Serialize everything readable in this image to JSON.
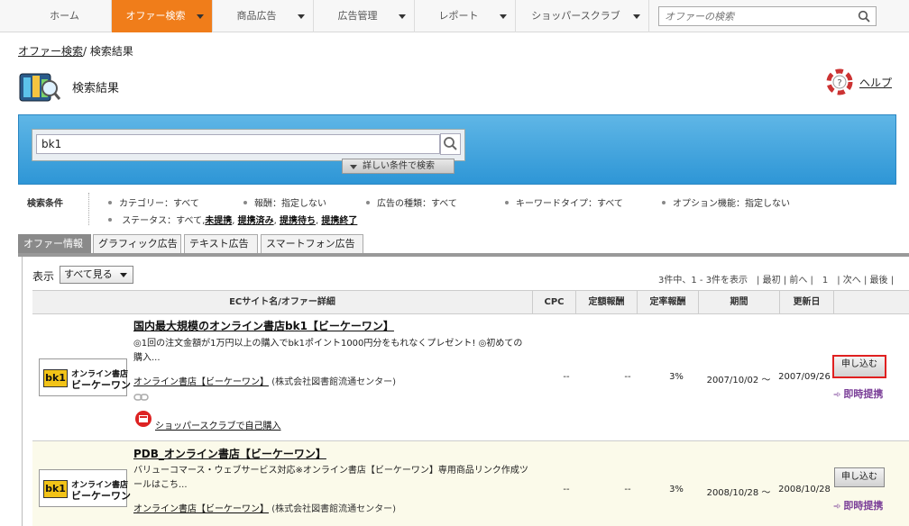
{
  "nav": {
    "items": [
      {
        "label": "ホーム",
        "active": false,
        "dropdown": false
      },
      {
        "label": "オファー検索",
        "active": true,
        "dropdown": true
      },
      {
        "label": "商品広告",
        "active": false,
        "dropdown": true
      },
      {
        "label": "広告管理",
        "active": false,
        "dropdown": true
      },
      {
        "label": "レポート",
        "active": false,
        "dropdown": true
      },
      {
        "label": "ショッパースクラブ",
        "active": false,
        "dropdown": true
      }
    ],
    "search_placeholder": "オファーの検索"
  },
  "breadcrumb": {
    "link": "オファー検索",
    "current": "/ 検索結果"
  },
  "page": {
    "title": "検索結果",
    "help": "ヘルプ"
  },
  "search": {
    "value": "bk1",
    "advanced_label": "詳しい条件で検索"
  },
  "conditions": {
    "label": "検索条件",
    "category": "カテゴリー：すべて",
    "reward": "報酬：指定しない",
    "ad_type": "広告の種類：すべて",
    "keyword_type": "キーワードタイプ：すべて",
    "option": "オプション機能：指定しない",
    "status_prefix": "ステータス：すべて,",
    "status_links": [
      "未提携",
      "提携済み",
      "提携待ち",
      "提携終了"
    ]
  },
  "tabs": [
    "オファー情報",
    "グラフィック広告",
    "テキスト広告",
    "スマートフォン広告"
  ],
  "list": {
    "view_label": "表示",
    "view_value": "すべて見る",
    "pager": "3件中、1 - 3件を表示　| 最初 | 前へ |　1　| 次へ | 最後 |",
    "headers": [
      "ECサイト名/オファー詳細",
      "CPC",
      "定額報酬",
      "定率報酬",
      "期間",
      "更新日"
    ],
    "rows": [
      {
        "logo_mark": "bk1",
        "logo_line1": "オンライン書店",
        "logo_line2": "ビーケーワン",
        "title": "国内最大規模のオンライン書店bk1【ビーケーワン】",
        "desc": "◎1回の注文金額が1万円以上の購入でbk1ポイント1000円分をもれなくプレゼント! ◎初めての購入...",
        "shop_link": "オンライン書店【ビーケーワン】",
        "shop_company": "(株式会社図書館流通センター)",
        "cpc": "--",
        "fixed": "--",
        "rate": "3%",
        "period": "2007/10/02 〜",
        "updated": "2007/09/26",
        "apply": "申し込む",
        "instant": "即時提携",
        "scrap": "ショッパースクラブで自己購入"
      },
      {
        "logo_mark": "bk1",
        "logo_line1": "オンライン書店",
        "logo_line2": "ビーケーワン",
        "title": "PDB_オンライン書店【ビーケーワン】",
        "desc": "バリューコマース・ウェブサービス対応※オンライン書店【ビーケーワン】専用商品リンク作成ツールはこち...",
        "shop_link": "オンライン書店【ビーケーワン】",
        "shop_company": "(株式会社図書館流通センター)",
        "cpc": "--",
        "fixed": "--",
        "rate": "3%",
        "period": "2008/10/28 〜",
        "updated": "2008/10/28",
        "apply": "申し込む",
        "instant": "即時提携"
      }
    ]
  },
  "colors": {
    "nav_active": "#f07d1a",
    "search_panel": "#3ea3de",
    "instant": "#7b3f98",
    "apply_highlight": "#e02020"
  }
}
